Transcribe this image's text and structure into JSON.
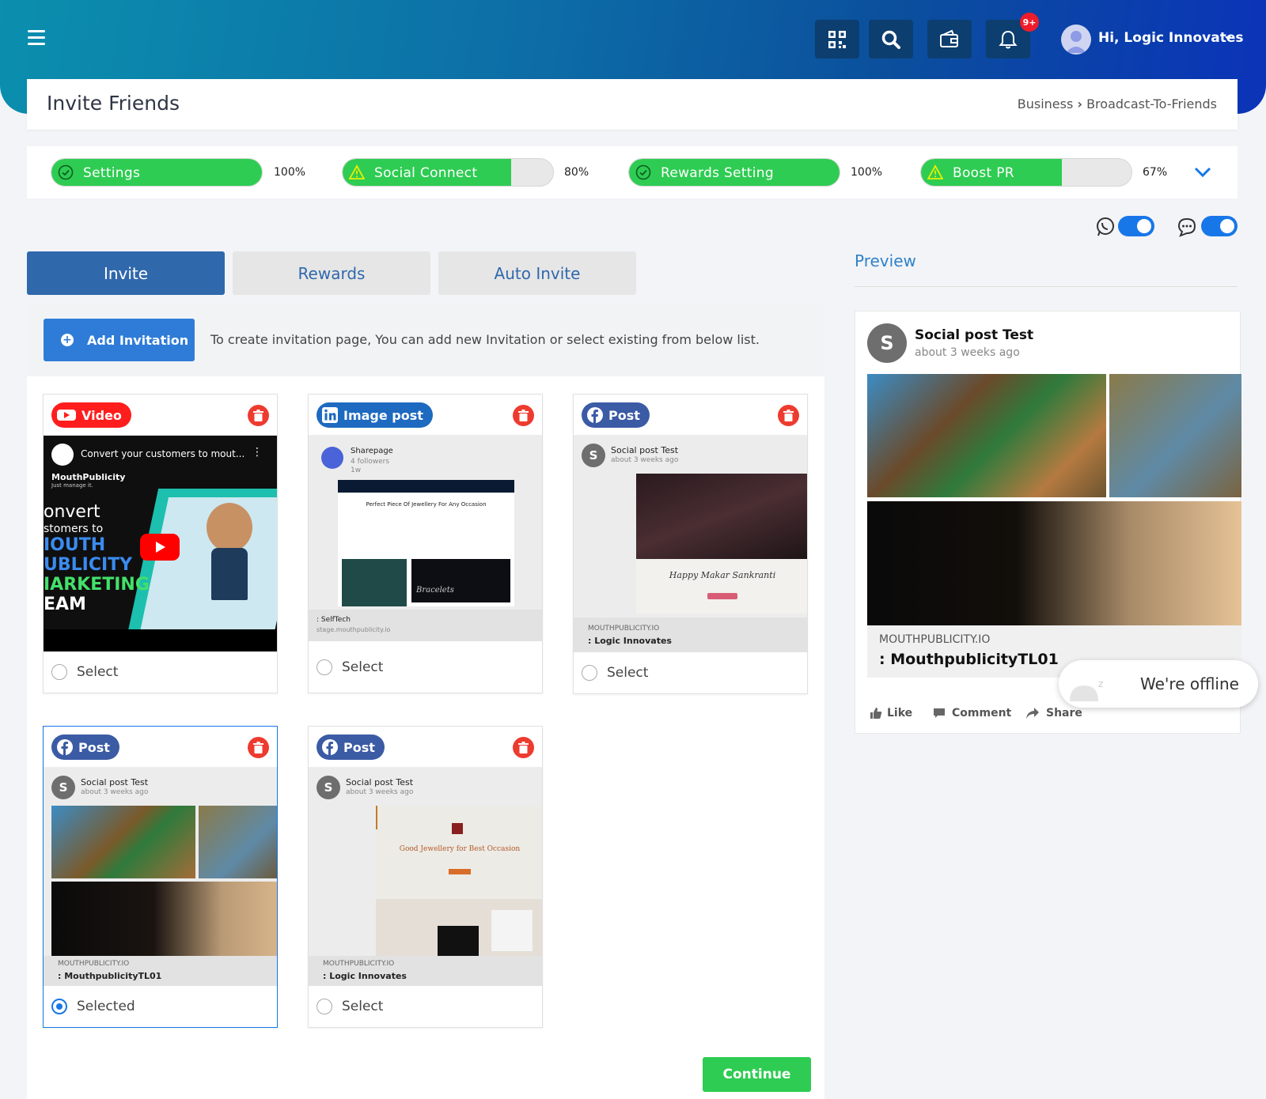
{
  "header": {
    "greeting": "Hi, Logic Innovates",
    "notification_badge": "9+"
  },
  "page": {
    "title": "Invite Friends",
    "breadcrumb": {
      "parent": "Business",
      "separator": "›",
      "current": "Broadcast-To-Friends"
    }
  },
  "progress": [
    {
      "label": "Settings",
      "percent_text": "100%",
      "value": 1.0,
      "status": "check"
    },
    {
      "label": "Social Connect",
      "percent_text": "80%",
      "value": 0.8,
      "status": "warning"
    },
    {
      "label": "Rewards Setting",
      "percent_text": "100%",
      "value": 1.0,
      "status": "check"
    },
    {
      "label": "Boost PR",
      "percent_text": "67%",
      "value": 0.67,
      "status": "warning"
    }
  ],
  "toggles": {
    "whatsapp": true,
    "sms": true
  },
  "tabs": {
    "invite": "Invite",
    "rewards": "Rewards",
    "auto_invite": "Auto Invite"
  },
  "add_invitation": {
    "label": "Add Invitation",
    "hint": "To create invitation page, You can add new Invitation or select existing from below list."
  },
  "cards": [
    {
      "type": "Video",
      "color": "#ff1d1d",
      "video_title": "Convert your customers to mout...",
      "brand": "MouthPublicity",
      "brand_sub": "Just manage it.",
      "lines": [
        "onvert",
        "stomers to",
        "IOUTH",
        "UBLICITY",
        "IARKETING",
        "EAM"
      ],
      "footer": "Select",
      "selected": false
    },
    {
      "type": "Image post",
      "color": "#1d6ac0",
      "page": "Sharepage",
      "followers": "4 followers",
      "age": "1w",
      "headline": "Perfect Piece Of Jewellery For Any Occasion",
      "overlay": "Bracelets",
      "site_title": ": SelfTech",
      "site_url": "stage.mouthpublicity.io",
      "footer": "Select",
      "selected": false
    },
    {
      "type": "Post",
      "color": "#3b5ba5",
      "post_title": "Social post Test",
      "age": "about 3 weeks ago",
      "caption": "Happy Makar Sankranti",
      "domain": "MOUTHPUBLICITY.IO",
      "site_title": ": Logic Innovates",
      "footer": "Select",
      "selected": false
    },
    {
      "type": "Post",
      "color": "#3b5ba5",
      "post_title": "Social post Test",
      "age": "about 3 weeks ago",
      "domain": "MOUTHPUBLICITY.IO",
      "site_title": ": MouthpublicityTL01",
      "footer": "Selected",
      "selected": true
    },
    {
      "type": "Post",
      "color": "#3b5ba5",
      "post_title": "Social post Test",
      "age": "about 3 weeks ago",
      "headline": "Good Jewellery for Best Occasion",
      "domain": "MOUTHPUBLICITY.IO",
      "site_title": ": Logic Innovates",
      "footer": "Select",
      "selected": false
    }
  ],
  "continue_label": "Continue",
  "preview": {
    "heading": "Preview",
    "post_title": "Social post Test",
    "age": "about 3 weeks ago",
    "domain": "MOUTHPUBLICITY.IO",
    "site_title": ": MouthpublicityTL01",
    "actions": {
      "like": "Like",
      "comment": "Comment",
      "share": "Share"
    }
  },
  "chat": {
    "status": "We're offline"
  }
}
